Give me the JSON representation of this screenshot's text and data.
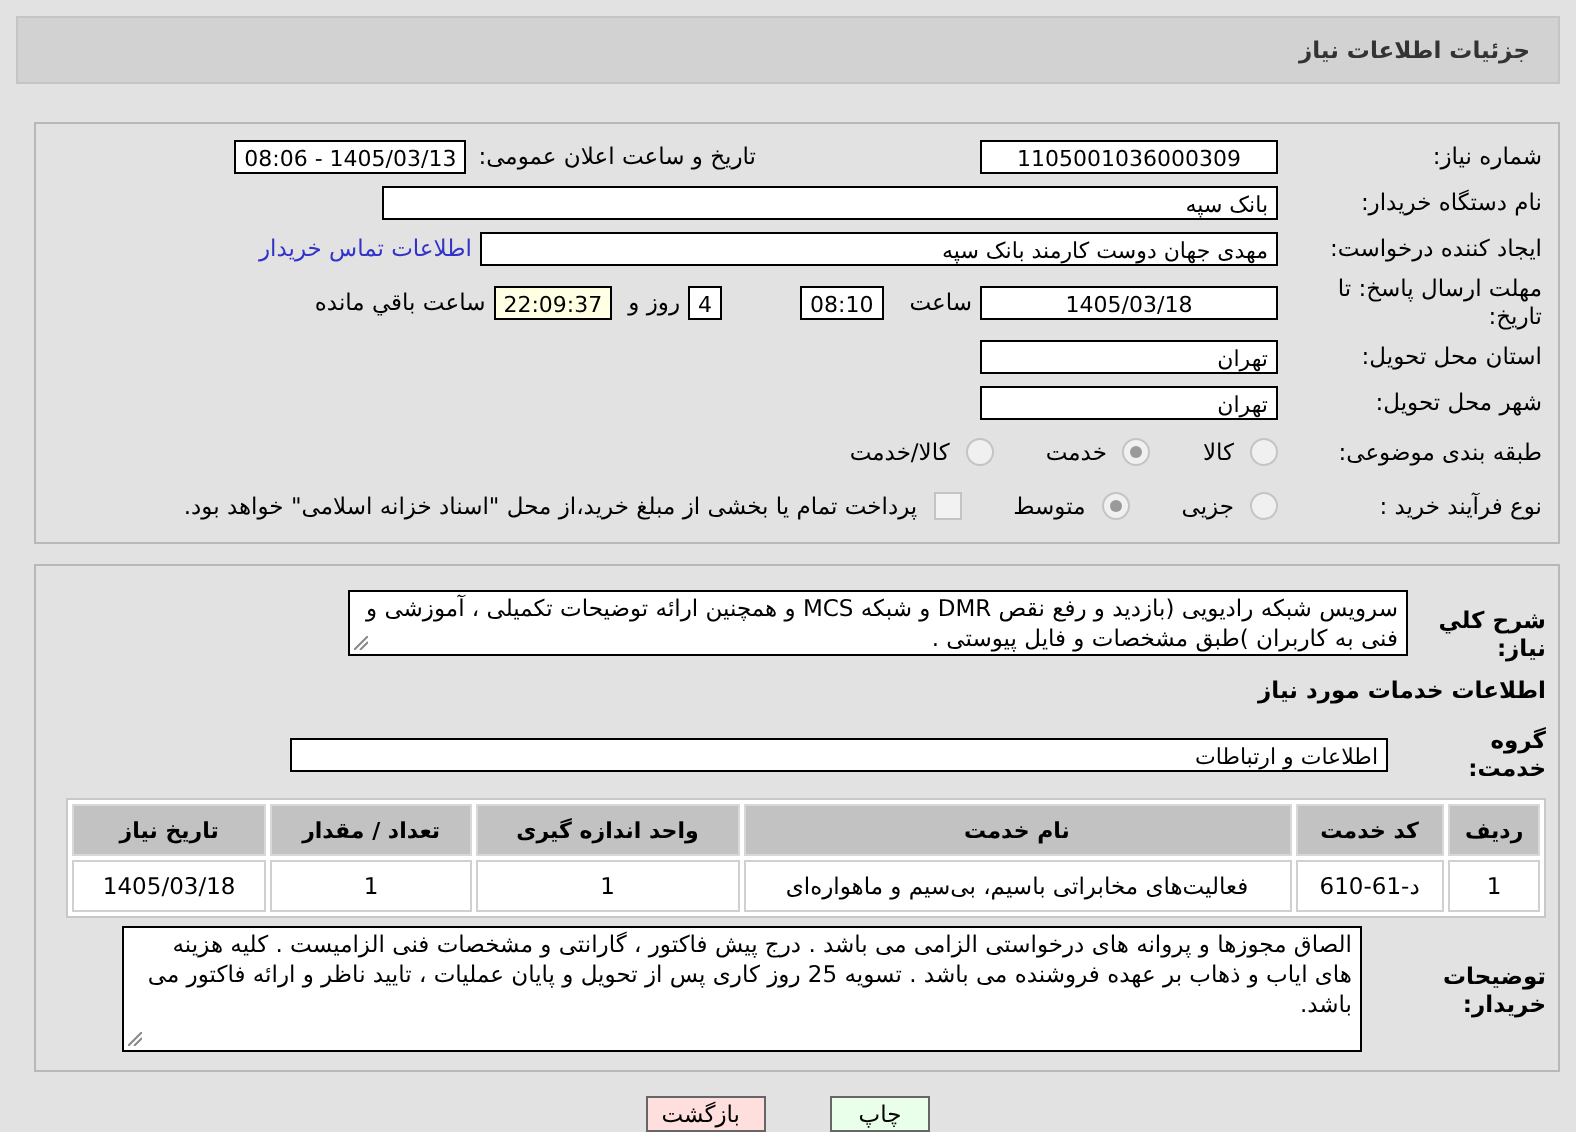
{
  "header": {
    "title": "جزئیات اطلاعات نیاز"
  },
  "info": {
    "need_number": {
      "label": "شماره نیاز:",
      "value": "1105001036000309"
    },
    "announce": {
      "label": "تاریخ و ساعت اعلان عمومی:",
      "value": "1405/03/13 - 08:06"
    },
    "buyer": {
      "label": "نام دستگاه خریدار:",
      "value": "بانک سپه"
    },
    "creator": {
      "label": "ایجاد کننده درخواست:",
      "value": "مهدی جهان دوست کارمند بانک سپه",
      "link": "اطلاعات تماس خریدار"
    },
    "deadline": {
      "label": "مهلت ارسال پاسخ: تا تاریخ:",
      "date": "1405/03/18",
      "time_label": "ساعت",
      "time": "08:10",
      "days": "4",
      "days_label": "روز و",
      "remaining": "22:09:37",
      "remaining_label": "ساعت باقي مانده"
    },
    "province": {
      "label": "استان محل تحویل:",
      "value": "تهران"
    },
    "city": {
      "label": "شهر محل تحویل:",
      "value": "تهران"
    },
    "category": {
      "label": "طبقه بندی موضوعی:",
      "options": [
        {
          "label": "کالا",
          "selected": false
        },
        {
          "label": "خدمت",
          "selected": true
        },
        {
          "label": "کالا/خدمت",
          "selected": false
        }
      ]
    },
    "process": {
      "label": "نوع فرآیند خرید :",
      "options": [
        {
          "label": "جزیی",
          "selected": false
        },
        {
          "label": "متوسط",
          "selected": true
        }
      ],
      "treasury": {
        "checked": false,
        "text": "پرداخت تمام یا بخشی از مبلغ خرید،از محل \"اسناد خزانه اسلامی\" خواهد بود."
      }
    }
  },
  "services": {
    "description": {
      "label": "شرح کلي نياز:",
      "text": "سرویس شبکه رادیویی (بازدید و رفع نقص DMR و شبکه MCS و همچنین ارائه توضیحات تکمیلی ، آموزشی و فنی به کاربران )طبق مشخصات و فایل پیوستی ."
    },
    "heading": "اطلاعات خدمات مورد نیاز",
    "group": {
      "label": "گروه خدمت:",
      "value": "اطلاعات و ارتباطات"
    },
    "table": {
      "columns": [
        "ردیف",
        "کد خدمت",
        "نام خدمت",
        "واحد اندازه گیری",
        "تعداد / مقدار",
        "تاریخ نیاز"
      ],
      "rows": [
        [
          "1",
          "د-61-610",
          "فعالیت‌های مخابراتی باسیم، بی‌سیم و ماهواره‌ای",
          "1",
          "1",
          "1405/03/18"
        ]
      ]
    },
    "notes": {
      "label": "توضیحات خریدار:",
      "text": "الصاق مجوزها و پروانه های درخواستی الزامی می باشد . درج پیش فاکتور ، گارانتی و مشخصات فنی الزامیست .  کلیه هزینه های ایاب و ذهاب بر عهده فروشنده می باشد . تسویه 25 روز کاری پس از تحویل و پایان عملیات ، تایید ناظر و ارائه فاکتور می باشد."
    }
  },
  "buttons": [
    {
      "kind": "print",
      "label": "چاپ"
    },
    {
      "kind": "back",
      "label": "بازگشت"
    }
  ]
}
